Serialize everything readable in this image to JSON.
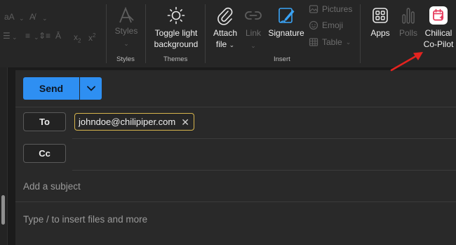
{
  "ribbon": {
    "font_glyphs": {
      "size_label": "aA",
      "format_painter": "A",
      "superscript": "x",
      "subscript_label": "x",
      "chevron": "⌄"
    },
    "styles": {
      "label": "Styles",
      "group": "Styles",
      "icon": "styles-icon"
    },
    "themes": {
      "label_line1": "Toggle light",
      "label_line2": "background",
      "group": "Themes",
      "icon": "sun-icon"
    },
    "insert": {
      "group": "Insert",
      "attach": {
        "label_line1": "Attach",
        "label_line2": "file",
        "icon": "paperclip-icon"
      },
      "link": {
        "label": "Link",
        "icon": "link-icon"
      },
      "signature": {
        "label": "Signature",
        "icon": "signature-icon"
      },
      "pictures": {
        "label": "Pictures",
        "icon": "picture-icon"
      },
      "emoji": {
        "label": "Emoji",
        "icon": "emoji-icon"
      },
      "table": {
        "label": "Table",
        "icon": "table-icon"
      }
    },
    "apps": {
      "label": "Apps",
      "icon": "apps-grid-icon"
    },
    "polls": {
      "label": "Polls",
      "icon": "polls-icon"
    },
    "copilot": {
      "label_line1": "Chilical",
      "label_line2": "Co-Pilot",
      "icon": "chilical-calendar-icon",
      "icon_color": "#e6375a"
    }
  },
  "compose": {
    "send_label": "Send",
    "to_label": "To",
    "cc_label": "Cc",
    "recipient": "johndoe@chilipiper.com",
    "subject_placeholder": "Add a subject",
    "body_placeholder": "Type / to insert files and more"
  },
  "colors": {
    "send_button": "#2e8ff2",
    "recipient_chip_border": "#d6b44d",
    "annotation_arrow": "#e4231f"
  }
}
